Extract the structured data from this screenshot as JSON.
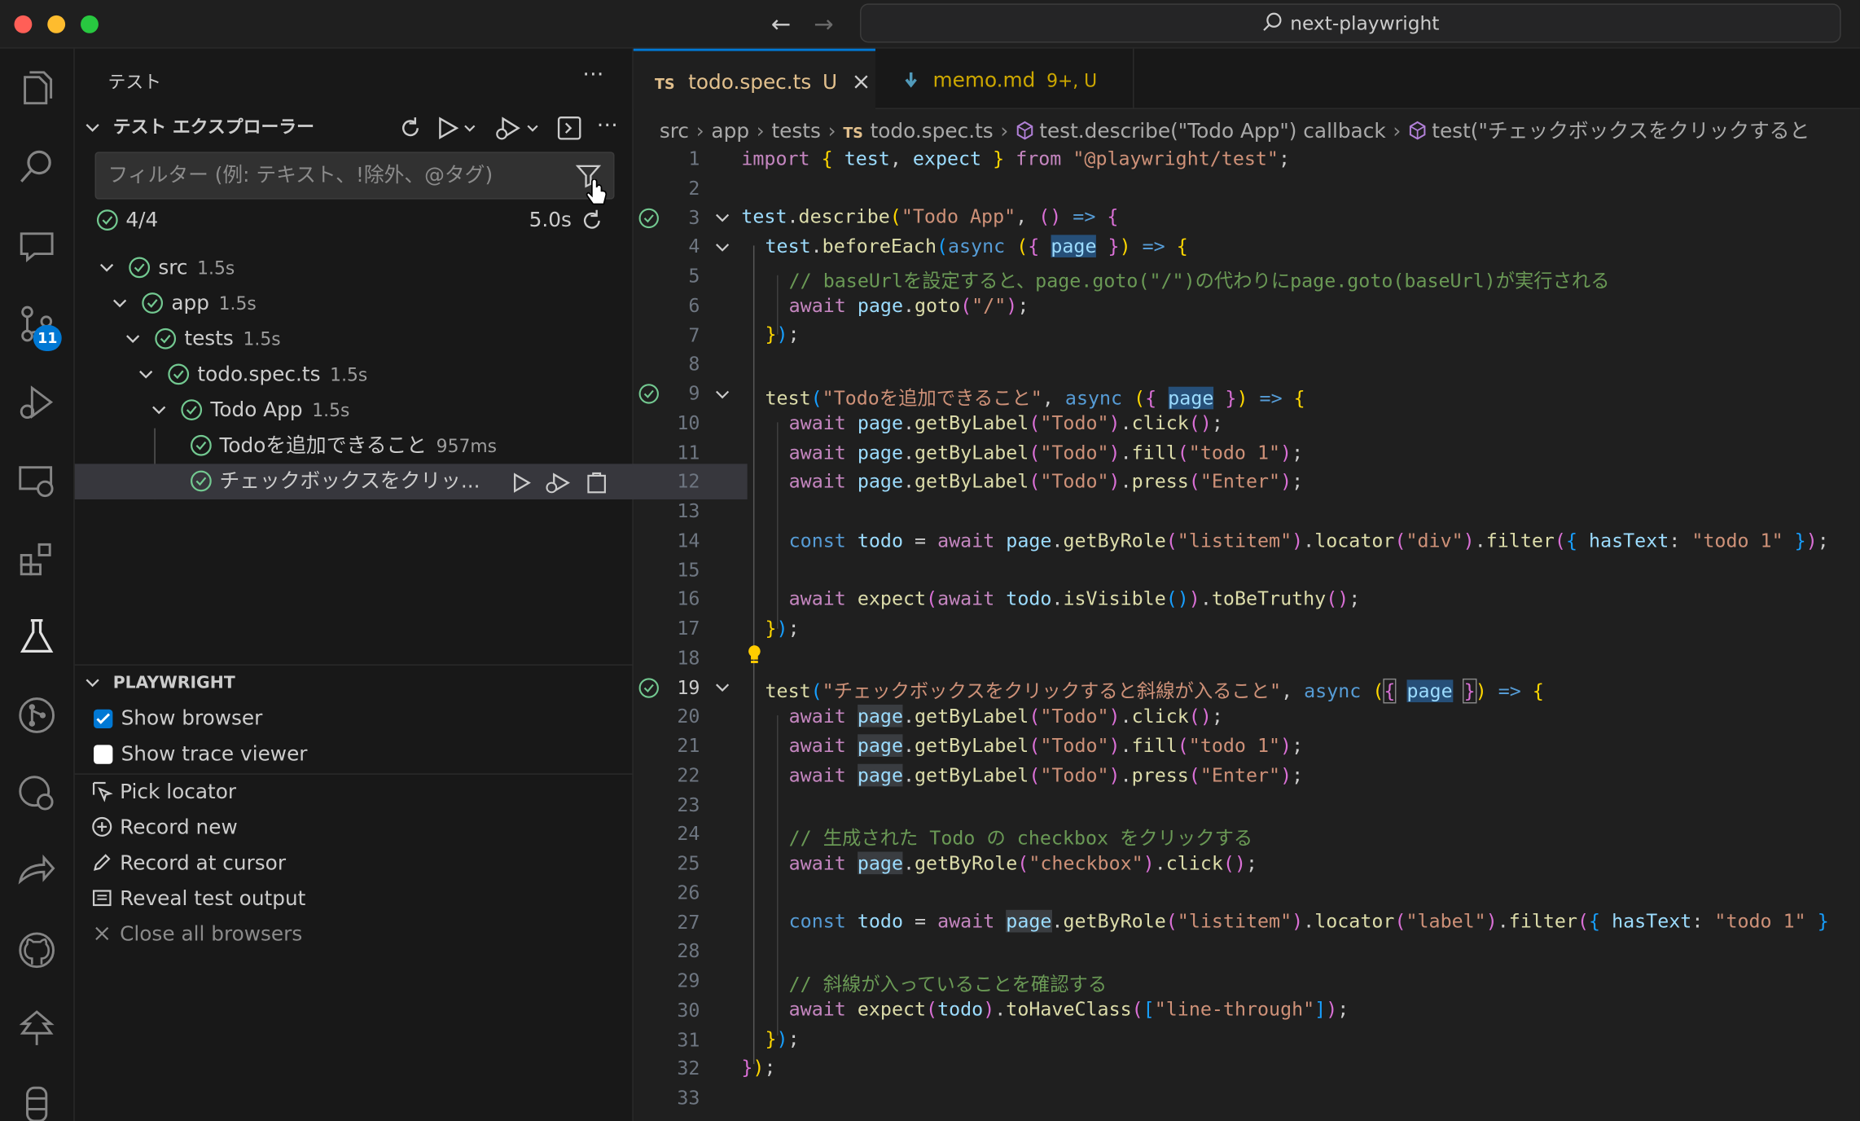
{
  "window": {
    "title": "next-playwright"
  },
  "sidebar": {
    "title": "テスト",
    "explorer_title": "テスト エクスプローラー",
    "filter_placeholder": "フィルター (例: テキスト、!除外、@タグ)",
    "summary": {
      "count": "4/4",
      "duration": "5.0s"
    },
    "tree": [
      {
        "label": "src",
        "duration": "1.5s"
      },
      {
        "label": "app",
        "duration": "1.5s"
      },
      {
        "label": "tests",
        "duration": "1.5s"
      },
      {
        "label": "todo.spec.ts",
        "duration": "1.5s"
      },
      {
        "label": "Todo App",
        "duration": "1.5s"
      },
      {
        "label": "Todoを追加できること",
        "duration": "957ms"
      },
      {
        "label": "チェックボックスをクリッ...",
        "duration": ""
      }
    ]
  },
  "playwright": {
    "title": "PLAYWRIGHT",
    "show_browser": "Show browser",
    "show_trace_viewer": "Show trace viewer",
    "actions": [
      "Pick locator",
      "Record new",
      "Record at cursor",
      "Reveal test output",
      "Close all browsers"
    ]
  },
  "activity": {
    "scm_badge": "11"
  },
  "tabs": [
    {
      "lang": "TS",
      "name": "todo.spec.ts",
      "status": "U"
    },
    {
      "name": "memo.md",
      "status": "9+, U"
    }
  ],
  "breadcrumb": [
    "src",
    "app",
    "tests",
    "todo.spec.ts",
    "test.describe(\"Todo App\") callback",
    "test(\"チェックボックスをクリックすると"
  ],
  "breadcrumb_ts": "TS",
  "editor": {
    "line_numbers": [
      "1",
      "2",
      "3",
      "4",
      "5",
      "6",
      "7",
      "8",
      "9",
      "10",
      "11",
      "12",
      "13",
      "14",
      "15",
      "16",
      "17",
      "18",
      "19",
      "20",
      "21",
      "22",
      "23",
      "24",
      "25",
      "26",
      "27",
      "28",
      "29",
      "30",
      "31",
      "32",
      "33"
    ],
    "strings": {
      "l1a": "import",
      "l1b": "{",
      "l1c": "test",
      "l1d": ",",
      "l1e": "expect",
      "l1f": "}",
      "l1g": "from",
      "l1h": "\"@playwright/test\"",
      "l1i": ";",
      "describe": "test.describe(",
      "todo_app": "\"Todo App\"",
      "arrow_open": ", () => {",
      "beforeEach": "test.beforeEach(",
      "async": "async",
      "page": "page",
      "c5": "// baseUrlを設定すると、page.goto(\"/\")の代わりにpage.goto(baseUrl)が実行される",
      "await": "await",
      "goto": "page.goto(",
      "slash": "\"/\"",
      "t9": "\"Todoを追加できること\"",
      "todo_label": "\"Todo\"",
      "todo1": "\"todo 1\"",
      "enter": "\"Enter\"",
      "listitem": "\"listitem\"",
      "div": "\"div\"",
      "label": "\"label\"",
      "checkbox": "\"checkbox\"",
      "t19": "\"チェックボックスをクリックすると斜線が入ること\"",
      "c24": "// 生成された Todo の checkbox をクリックする",
      "c29": "// 斜線が入っていることを確認する",
      "linethrough": "\"line-through\""
    }
  }
}
